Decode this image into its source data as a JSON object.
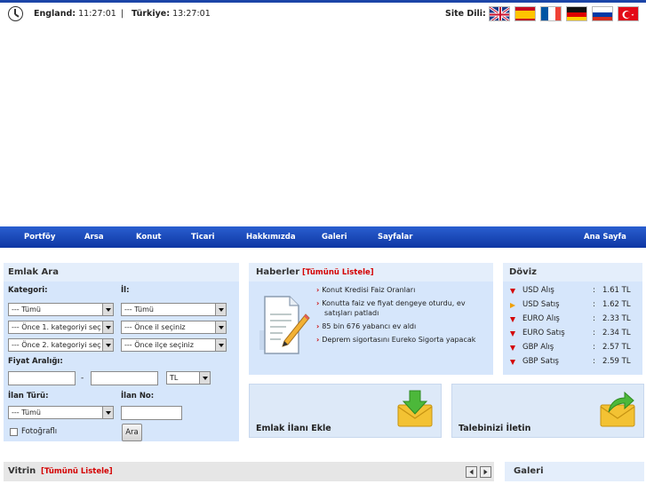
{
  "clocks": {
    "england_label": "England:",
    "england_time": "11:27:01",
    "separator": "|",
    "turkiye_label": "Türkiye:",
    "turkiye_time": "13:27:01"
  },
  "site_language": {
    "label": "Site Dili:",
    "flags": [
      "uk-flag-icon",
      "spain-flag-icon",
      "france-flag-icon",
      "germany-flag-icon",
      "russia-flag-icon",
      "turkey-flag-icon"
    ]
  },
  "nav": {
    "items": [
      "Portföy",
      "Arsa",
      "Konut",
      "Ticari",
      "Hakkımızda",
      "Galeri",
      "Sayfalar"
    ],
    "home": "Ana Sayfa"
  },
  "search": {
    "title": "Emlak Ara",
    "kategori_label": "Kategori:",
    "il_label": "İl:",
    "kategori_value": "--- Tümü",
    "il_value": "--- Tümü",
    "sub1_value": "--- Önce 1. kategoriyi seç",
    "ilce_prompt_value": "--- Önce il seçiniz",
    "sub2_value": "--- Önce 2. kategoriyi seç",
    "mahalle_value": "--- Önce ilçe seçiniz",
    "price_label": "Fiyat Aralığı:",
    "price_dash": "-",
    "currency_value": "TL",
    "ilan_turu_label": "İlan Türü:",
    "ilan_no_label": "İlan No:",
    "ilan_turu_value": "--- Tümü",
    "photo_label": "Fotoğraflı",
    "search_button": "Ara"
  },
  "news": {
    "title": "Haberler",
    "list_all": "[Tümünü Listele]",
    "items": [
      "Konut Kredisi Faiz Oranları",
      "Konutta faiz ve fiyat dengeye oturdu, ev satışları patladı",
      "85 bin 676 yabancı ev aldı",
      "Deprem sigortasını Eureko Sigorta yapacak"
    ]
  },
  "currency": {
    "title": "Döviz",
    "rows": [
      {
        "name": "USD Alış",
        "value": "1.61 TL",
        "trend": "down"
      },
      {
        "name": "USD Satış",
        "value": "1.62 TL",
        "trend": "right"
      },
      {
        "name": "EURO Alış",
        "value": "2.33 TL",
        "trend": "down"
      },
      {
        "name": "EURO Satış",
        "value": "2.34 TL",
        "trend": "down"
      },
      {
        "name": "GBP Alış",
        "value": "2.57 TL",
        "trend": "down"
      },
      {
        "name": "GBP Satış",
        "value": "2.59 TL",
        "trend": "down"
      }
    ],
    "colon": ":"
  },
  "actions": {
    "add_listing": "Emlak İlanı Ekle",
    "send_request": "Talebinizi İletin"
  },
  "showcase": {
    "title": "Vitrin",
    "list_all": "[Tümünü Listele]"
  },
  "gallery": {
    "title": "Galeri"
  },
  "colors": {
    "nav_blue": "#1c45a8",
    "panel_blue": "#d6e6fb",
    "accent_red": "#d40000"
  }
}
